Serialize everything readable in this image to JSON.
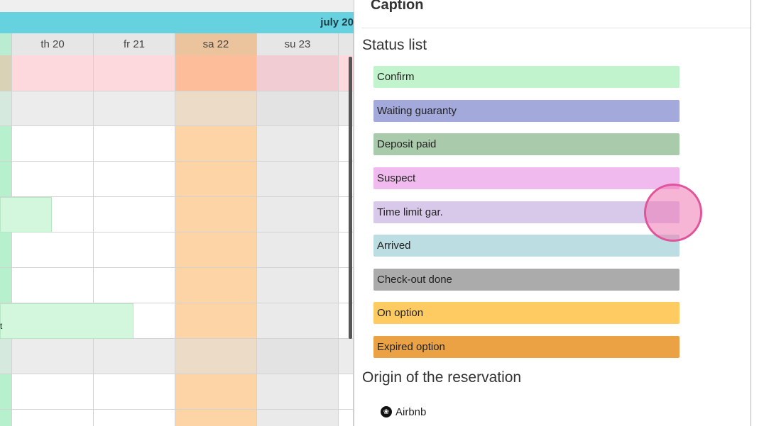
{
  "calendar": {
    "month_label": "july 20",
    "days": [
      {
        "label": "",
        "kind": "green"
      },
      {
        "label": "th 20",
        "kind": "normal"
      },
      {
        "label": "fr 21",
        "kind": "normal"
      },
      {
        "label": "sa 22",
        "kind": "weekend"
      },
      {
        "label": "su 23",
        "kind": "sunday"
      }
    ],
    "bookings": [
      {
        "label": "",
        "row": 4
      },
      {
        "label": "t",
        "row": 7
      }
    ]
  },
  "panel": {
    "title": "Caption",
    "status_section": "Status list",
    "statuses": [
      {
        "label": "Confirm",
        "color": "#c1f4cc"
      },
      {
        "label": "Waiting guaranty",
        "color": "#a3a9db"
      },
      {
        "label": "Deposit paid",
        "color": "#a9caab"
      },
      {
        "label": "Suspect",
        "color": "#f1baee"
      },
      {
        "label": "Time limit gar.",
        "color": "#d8c9ea"
      },
      {
        "label": "Arrived",
        "color": "#bcdde1"
      },
      {
        "label": "Check-out done",
        "color": "#ababab"
      },
      {
        "label": "On option",
        "color": "#fdcb61"
      },
      {
        "label": "Expired option",
        "color": "#eba245"
      }
    ],
    "origin_section": "Origin of the reservation",
    "origins": [
      {
        "label": "Airbnb",
        "icon": "airbnb-icon"
      }
    ]
  }
}
